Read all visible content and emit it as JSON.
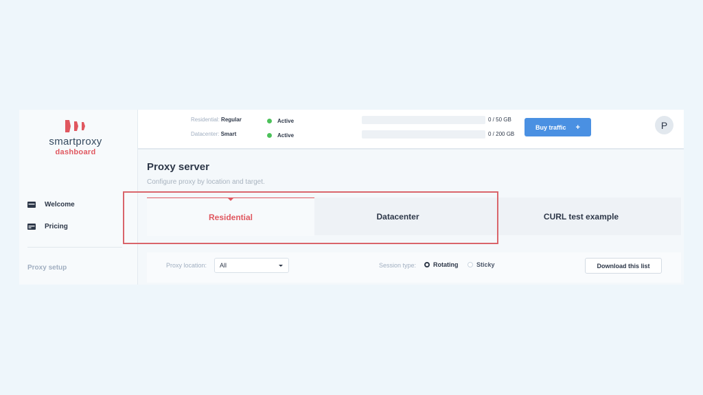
{
  "brand": {
    "name": "smartproxy",
    "subtitle": "dashboard",
    "accent_color": "#e0575f"
  },
  "sidebar": {
    "items": [
      {
        "label": "Welcome",
        "icon": "card-icon"
      },
      {
        "label": "Pricing",
        "icon": "card-icon"
      }
    ],
    "section_label": "Proxy setup"
  },
  "header": {
    "plans": [
      {
        "type_label": "Residential:",
        "plan": "Regular",
        "status": "Active",
        "usage": "0 / 50 GB",
        "usage_fraction": 0
      },
      {
        "type_label": "Datacenter:",
        "plan": "Smart",
        "status": "Active",
        "usage": "0 / 200 GB",
        "usage_fraction": 0
      }
    ],
    "status_color": "#4cc15a",
    "buy_button": {
      "label": "Buy traffic",
      "icon": "+",
      "color": "#4a90e2"
    },
    "avatar_initial": "P"
  },
  "main": {
    "title": "Proxy server",
    "subtitle": "Configure proxy by location and target.",
    "tabs": [
      {
        "label": "Residential",
        "active": true
      },
      {
        "label": "Datacenter",
        "active": false
      },
      {
        "label": "CURL test example",
        "active": false
      }
    ],
    "filters": {
      "location_label": "Proxy location:",
      "location_value": "All",
      "session_label": "Session type:",
      "session_options": [
        {
          "label": "Rotating",
          "checked": true
        },
        {
          "label": "Sticky",
          "checked": false
        }
      ],
      "download_label": "Download this list"
    }
  },
  "annotation": {
    "highlight_color": "#d9646a"
  }
}
